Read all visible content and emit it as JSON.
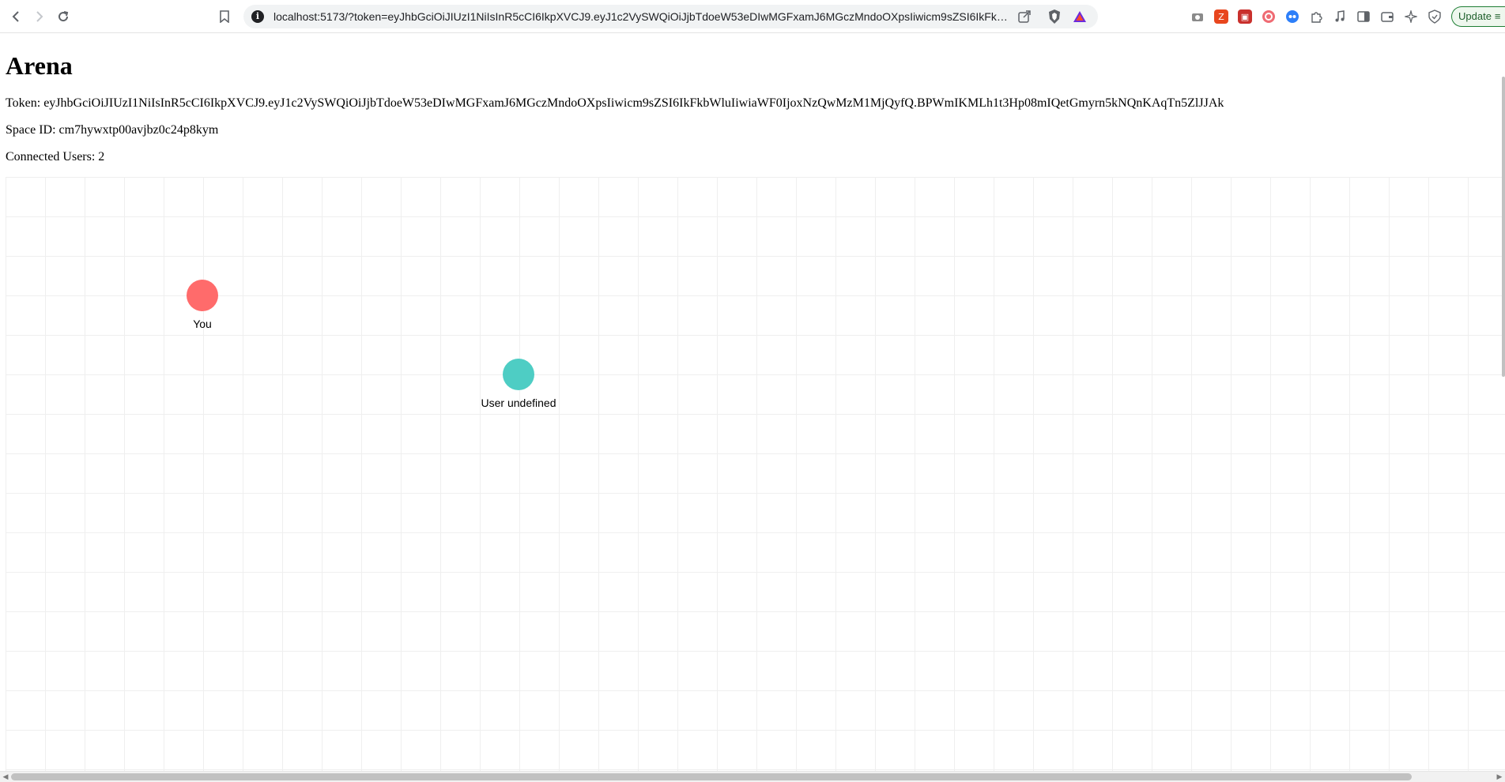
{
  "browser": {
    "url": "localhost:5173/?token=eyJhbGciOiJIUzI1NiIsInR5cCI6IkpXVCJ9.eyJ1c2VySWQiOiJjbTdoeW53eDIwMGFxamJ6MGczMndoOXpsIiwicm9sZSI6IkFkbWluIi...",
    "update_label": "Update",
    "icons": [
      "back-icon",
      "forward-icon",
      "reload-icon",
      "bookmark-icon",
      "site-info-icon",
      "share-icon",
      "brave-shield-icon",
      "brave-rewards-icon"
    ],
    "extensions": [
      "camera-icon",
      "zotero-icon",
      "pdf-icon",
      "target-icon",
      "extension-blue-icon",
      "puzzle-icon",
      "music-icon",
      "sidebar-icon",
      "wallet-icon",
      "leo-icon",
      "vpn-icon"
    ]
  },
  "page": {
    "title": "Arena",
    "token_line": "Token: eyJhbGciOiJIUzI1NiIsInR5cCI6IkpXVCJ9.eyJ1c2VySWQiOiJjbTdoeW53eDIwMGFxamJ6MGczMndoOXpsIiwicm9sZSI6IkFkbWluIiwiaWF0IjoxNzQwMzM1MjQyfQ.BPWmIKMLh1t3Hp08mIQetGmyrn5kNQnKAqTn5ZlJJAk",
    "space_line": "Space ID: cm7hywxtp00avjbz0c24p8kym",
    "users_line": "Connected Users: 2"
  },
  "arena": {
    "users": [
      {
        "label": "You",
        "color": "#ff6b6b"
      },
      {
        "label": "User undefined",
        "color": "#4ecdc4"
      }
    ]
  }
}
